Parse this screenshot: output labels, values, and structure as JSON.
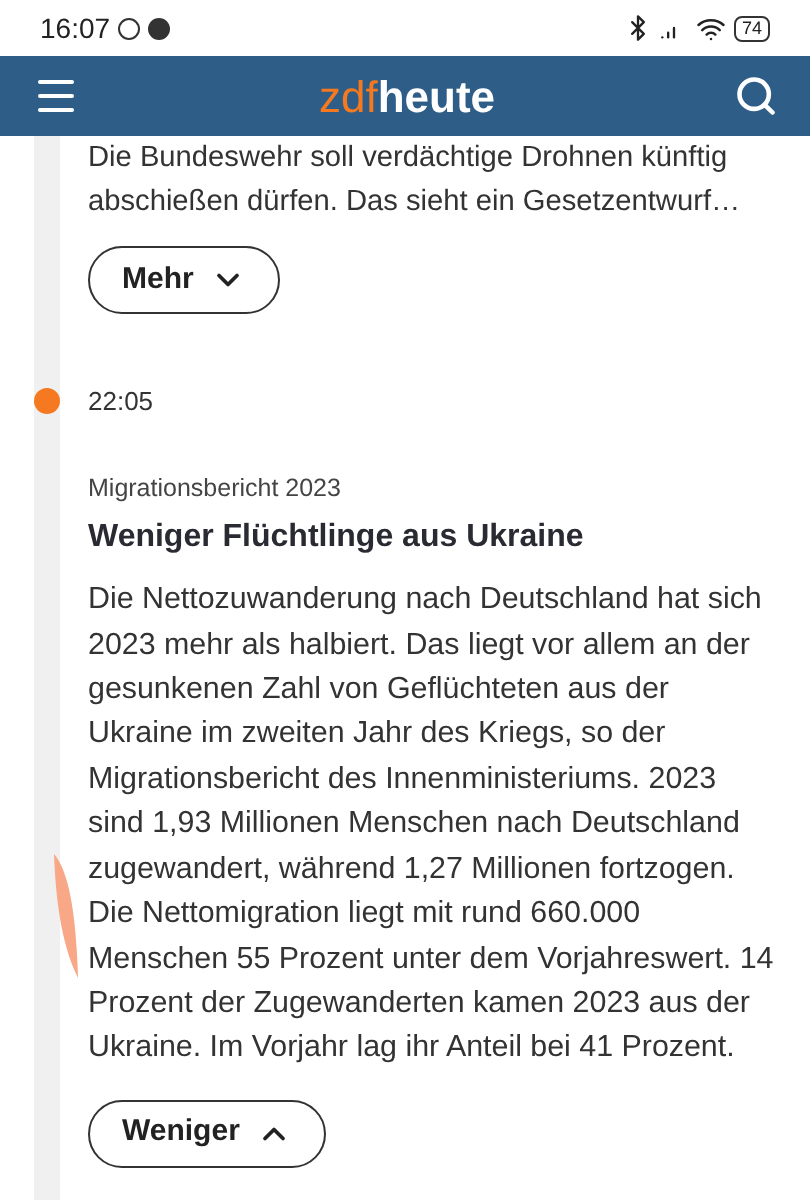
{
  "status_bar": {
    "time": "16:07",
    "battery": "74"
  },
  "header": {
    "logo_prefix": "zdf",
    "logo_main": "heute"
  },
  "entries": [
    {
      "kind": "tail",
      "body": "Die Bundeswehr soll verdächtige Drohnen künftig abschießen dürfen. Das sieht ein Gesetzentwurf…",
      "toggle": {
        "label": "Mehr",
        "expanded": false
      }
    },
    {
      "kind": "full",
      "time": "22:05",
      "topic": "Migrationsbericht 2023",
      "title": "Weniger Flüchtlinge aus Ukraine",
      "body": "Die Nettozuwanderung nach Deutschland hat sich 2023 mehr als halbiert. Das liegt vor allem an der gesunkenen Zahl von Geflüchteten aus der Ukraine im zweiten Jahr des Kriegs, so der Migrationsbericht des Innenministeriums. 2023 sind 1,93 Millionen Menschen nach Deutschland zugewandert, während 1,27 Millionen fortzogen. Die Nettomigration liegt mit rund 660.000 Menschen 55 Prozent unter dem Vorjahreswert. 14 Prozent der Zugewanderten kamen 2023 aus der Ukraine. Im Vorjahr lag ihr Anteil bei 41 Prozent.",
      "toggle": {
        "label": "Weniger",
        "expanded": true
      }
    }
  ]
}
